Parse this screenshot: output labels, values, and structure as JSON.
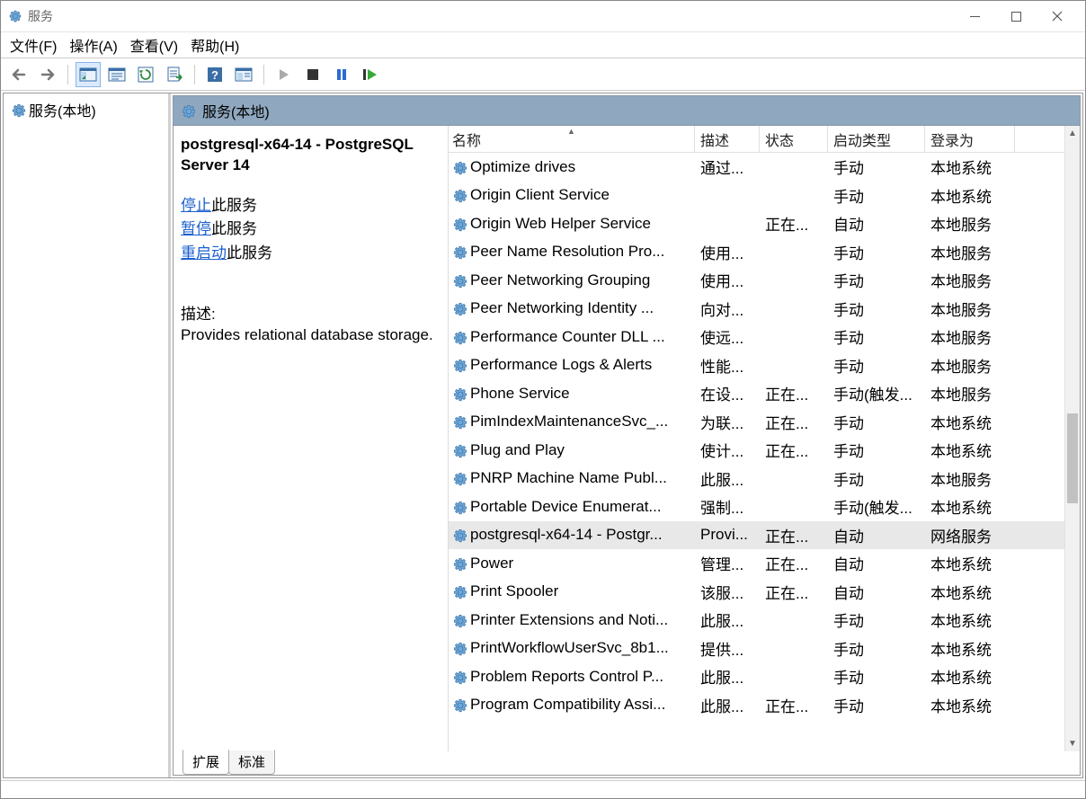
{
  "window_title": "服务",
  "menus": {
    "file": "文件(F)",
    "action": "操作(A)",
    "view": "查看(V)",
    "help": "帮助(H)"
  },
  "tree": {
    "root": "服务(本地)"
  },
  "panel_title": "服务(本地)",
  "detail": {
    "title": "postgresql-x64-14 - PostgreSQL Server 14",
    "stop_link": "停止",
    "stop_suffix": "此服务",
    "pause_link": "暂停",
    "pause_suffix": "此服务",
    "restart_link": "重启动",
    "restart_suffix": "此服务",
    "desc_label": "描述:",
    "desc_text": "Provides relational database storage."
  },
  "columns": {
    "name": "名称",
    "desc": "描述",
    "status": "状态",
    "start": "启动类型",
    "login": "登录为"
  },
  "services": [
    {
      "name": "Optimize drives",
      "desc": "通过...",
      "status": "",
      "start": "手动",
      "login": "本地系统"
    },
    {
      "name": "Origin Client Service",
      "desc": "",
      "status": "",
      "start": "手动",
      "login": "本地系统"
    },
    {
      "name": "Origin Web Helper Service",
      "desc": "",
      "status": "正在...",
      "start": "自动",
      "login": "本地服务"
    },
    {
      "name": "Peer Name Resolution Pro...",
      "desc": "使用...",
      "status": "",
      "start": "手动",
      "login": "本地服务"
    },
    {
      "name": "Peer Networking Grouping",
      "desc": "使用...",
      "status": "",
      "start": "手动",
      "login": "本地服务"
    },
    {
      "name": "Peer Networking Identity ...",
      "desc": "向对...",
      "status": "",
      "start": "手动",
      "login": "本地服务"
    },
    {
      "name": "Performance Counter DLL ...",
      "desc": "使远...",
      "status": "",
      "start": "手动",
      "login": "本地服务"
    },
    {
      "name": "Performance Logs & Alerts",
      "desc": "性能...",
      "status": "",
      "start": "手动",
      "login": "本地服务"
    },
    {
      "name": "Phone Service",
      "desc": "在设...",
      "status": "正在...",
      "start": "手动(触发...",
      "login": "本地服务"
    },
    {
      "name": "PimIndexMaintenanceSvc_...",
      "desc": "为联...",
      "status": "正在...",
      "start": "手动",
      "login": "本地系统"
    },
    {
      "name": "Plug and Play",
      "desc": "使计...",
      "status": "正在...",
      "start": "手动",
      "login": "本地系统"
    },
    {
      "name": "PNRP Machine Name Publ...",
      "desc": "此服...",
      "status": "",
      "start": "手动",
      "login": "本地服务"
    },
    {
      "name": "Portable Device Enumerat...",
      "desc": "强制...",
      "status": "",
      "start": "手动(触发...",
      "login": "本地系统"
    },
    {
      "name": "postgresql-x64-14 - Postgr...",
      "desc": "Provi...",
      "status": "正在...",
      "start": "自动",
      "login": "网络服务",
      "selected": true
    },
    {
      "name": "Power",
      "desc": "管理...",
      "status": "正在...",
      "start": "自动",
      "login": "本地系统"
    },
    {
      "name": "Print Spooler",
      "desc": "该服...",
      "status": "正在...",
      "start": "自动",
      "login": "本地系统"
    },
    {
      "name": "Printer Extensions and Noti...",
      "desc": "此服...",
      "status": "",
      "start": "手动",
      "login": "本地系统"
    },
    {
      "name": "PrintWorkflowUserSvc_8b1...",
      "desc": "提供...",
      "status": "",
      "start": "手动",
      "login": "本地系统"
    },
    {
      "name": "Problem Reports Control P...",
      "desc": "此服...",
      "status": "",
      "start": "手动",
      "login": "本地系统"
    },
    {
      "name": "Program Compatibility Assi...",
      "desc": "此服...",
      "status": "正在...",
      "start": "手动",
      "login": "本地系统"
    }
  ],
  "tabs": {
    "extended": "扩展",
    "standard": "标准"
  }
}
